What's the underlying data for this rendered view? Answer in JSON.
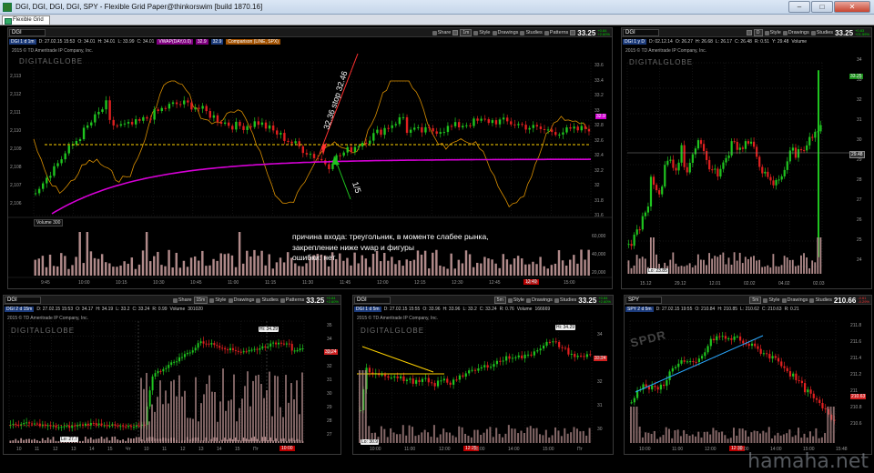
{
  "window": {
    "title": "DGI, DGI, DGI, DGI, SPY - Flexible Grid Paper@thinkorswim [build 1870.16]",
    "tab": "Flexible Grid"
  },
  "toolbar_labels": {
    "share": "Share",
    "style": "Style",
    "drawings": "Drawings",
    "studies": "Studies",
    "patterns": "Patterns"
  },
  "panels": {
    "main": {
      "symbol": "DGI",
      "price": "33.25",
      "change_top": "+0.84",
      "change_bottom": "+2.60%",
      "timeframe": "1m",
      "info": {
        "label": "DGI 1 d 1m",
        "date": "D: 27.02.15 15:53",
        "open": "O: 34.01",
        "high": "H: 34.01",
        "low": "L: 33.99",
        "close": "C: 34.01",
        "vwap": "VWAP(DAY,0.0)",
        "vwap_value": "32.9",
        "vwap_value2": "32.9",
        "comparison": "Comparison (LINE, SPX)"
      },
      "copyright": "2015 © TD Ameritrade IP Company, Inc.",
      "brand": "DIGITALGLOBE",
      "price_ticks": [
        "33.6",
        "33.4",
        "33.2",
        "33",
        "32.8",
        "32.6",
        "32.4",
        "32.2",
        "32",
        "31.8",
        "31.6"
      ],
      "left_ticks": [
        "2,113",
        "2,112",
        "2,111",
        "2,110",
        "2,109",
        "2,108",
        "2,107",
        "2,106"
      ],
      "current_label": "32.9",
      "volume_label": "Volume",
      "volume_value": "300",
      "volume_ticks": [
        "60,000",
        "40,000",
        "20,000"
      ],
      "time_ticks": [
        "9:45",
        "10:00",
        "10:15",
        "10:30",
        "10:45",
        "11:00",
        "11:15",
        "11:30",
        "11:45",
        "12:00",
        "12:15",
        "12:30",
        "12:45",
        "13:00",
        "15:00"
      ],
      "clock": "12:40",
      "annotation_stop": "32.36 stop 32.46",
      "annotation_entry": "1/5"
    },
    "daily": {
      "symbol": "DGI",
      "price": "33.25",
      "change_top": "+0.83",
      "change_bottom": "+21.59%",
      "timeframe": "D",
      "info": {
        "label": "DGI 1 y D",
        "date": "D: 02.12.14",
        "open": "O: 26.27",
        "high": "H: 26.68",
        "low": "L: 26.17",
        "close": "C: 26.48",
        "extra": "R: 0.51",
        "y": "Y: 29.48",
        "volume": "Volume"
      },
      "copyright": "2015 © TD Ameritrade IP Company, Inc.",
      "brand": "DIGITALGLOBE",
      "price_ticks": [
        "34",
        "33",
        "32",
        "31",
        "30",
        "29",
        "28",
        "27",
        "26",
        "25",
        "24"
      ],
      "current_label": "33.25",
      "line_label": "29.48",
      "low_label": "Lo: 23.85",
      "time_ticks": [
        "15.12",
        "29.12",
        "12.01",
        "02.02",
        "04.02",
        "02.03"
      ]
    },
    "m15": {
      "symbol": "DGI",
      "price": "33.25",
      "change_top": "+0.84",
      "change_bottom": "+2.60%",
      "timeframe": "15m",
      "info": {
        "label": "DGI 2 d 15m",
        "date": "D: 27.02.15 15:53",
        "open": "O: 34.17",
        "high": "H: 34.19",
        "low": "L: 33.2",
        "close": "C: 33.24",
        "extra": "R: 0.99",
        "volume": "Volume",
        "vol_value": "301020"
      },
      "copyright": "2015 © TD Ameritrade IP Company, Inc.",
      "brand": "DIGITALGLOBE",
      "hi_label": "Hi: 34.29",
      "lo_label": "Lo: 27.7",
      "current_label": "33.24",
      "price_ticks": [
        "35",
        "34",
        "33",
        "32",
        "31",
        "30",
        "29",
        "28",
        "27"
      ],
      "time_ticks": [
        "10",
        "11",
        "12",
        "13",
        "14",
        "15",
        "Чт",
        "10",
        "11",
        "12",
        "13",
        "14",
        "15",
        "Пт"
      ],
      "clock": "10:00"
    },
    "m5": {
      "symbol": "DGI",
      "price": "33.25",
      "change_top": "+0.84",
      "change_bottom": "+2.60%",
      "timeframe": "5m",
      "info": {
        "label": "DGI 1 d 5m",
        "date": "D: 27.02.15 15:55",
        "open": "O: 33.96",
        "high": "H: 33.96",
        "low": "L: 33.2",
        "close": "C: 33.24",
        "extra": "R: 0.76",
        "volume": "Volume",
        "vol_value": "166669"
      },
      "copyright": "2015 © TD Ameritrade IP Company, Inc.",
      "brand": "DIGITALGLOBE",
      "hi_label": "Hi: 34.29",
      "lo_label": "Lo: 30.9",
      "current_label": "33.24",
      "price_ticks": [
        "34",
        "33",
        "32",
        "31",
        "30"
      ],
      "time_ticks": [
        "10:00",
        "11:00",
        "12:00",
        "13:00",
        "14:00",
        "15:00",
        "Пт"
      ],
      "clock": "12:25"
    },
    "spy": {
      "symbol": "SPY",
      "price": "210.66",
      "change_top": "-0.61",
      "change_bottom": "-0.29%",
      "timeframe": "5m",
      "info": {
        "label": "SPY 2 d 5m",
        "date": "D: 27.02.15 19:55",
        "open": "O: 210.84",
        "high": "H: 210.85",
        "low": "L: 210.62",
        "close": "C: 210.63",
        "extra": "R: 0.21"
      },
      "current_label": "210.63",
      "price_ticks": [
        "211.8",
        "211.6",
        "211.4",
        "211.2",
        "211",
        "210.8",
        "210.6"
      ],
      "time_ticks": [
        "10:00",
        "11:00",
        "12:00",
        "13:00",
        "14:00",
        "15:00",
        "15:48"
      ],
      "clock": "12:30"
    }
  },
  "note": {
    "line1": "причина входа: треугольник, в моменте слабее рынка,",
    "line2": "закрепление ниже vwap и фигуры",
    "line3": "ошибки: нет"
  },
  "watermark": "hamaha.net",
  "colors": {
    "up": "#1fc41f",
    "down": "#e02020",
    "vwap": "#d600d6",
    "comparison": "#d98f00",
    "annotation": "#ff3030",
    "trend": "#ffd200",
    "spy_trend": "#2aa8ff"
  }
}
